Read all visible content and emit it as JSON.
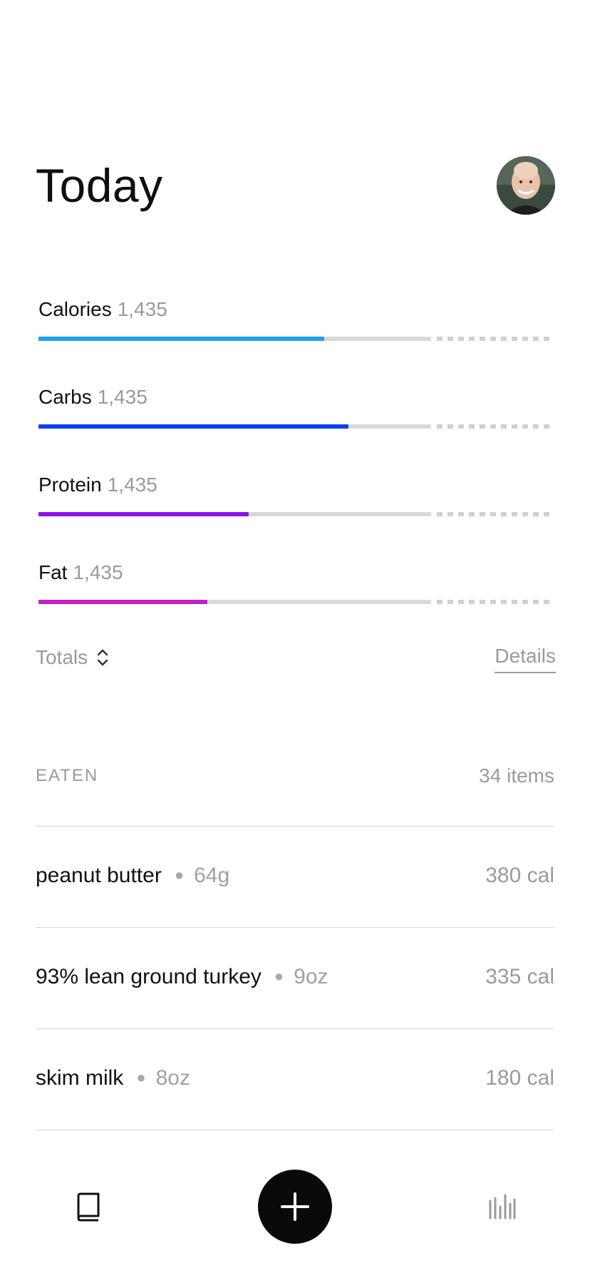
{
  "header": {
    "title": "Today",
    "avatar_icon": "user-avatar"
  },
  "metrics": [
    {
      "name": "Calories",
      "value": "1,435",
      "progress": 0.728,
      "color": "#1ba1ec"
    },
    {
      "name": "Carbs",
      "value": "1,435",
      "progress": 0.789,
      "color": "#0c3ff0"
    },
    {
      "name": "Protein",
      "value": "1,435",
      "progress": 0.535,
      "color": "#8d12ea"
    },
    {
      "name": "Fat",
      "value": "1,435",
      "progress": 0.43,
      "color": "#c61ec4"
    }
  ],
  "controls": {
    "totals_label": "Totals",
    "details_label": "Details"
  },
  "eaten": {
    "heading": "EATEN",
    "count": "34 items",
    "items": [
      {
        "name": "peanut butter",
        "qty": "64g",
        "cal": "380 cal"
      },
      {
        "name": "93% lean ground turkey",
        "qty": "9oz",
        "cal": "335 cal"
      },
      {
        "name": "skim milk",
        "qty": "8oz",
        "cal": "180 cal"
      }
    ]
  },
  "tabbar": {
    "left_icon": "book-icon",
    "center_icon": "plus-icon",
    "right_icon": "bar-chart-icon"
  }
}
